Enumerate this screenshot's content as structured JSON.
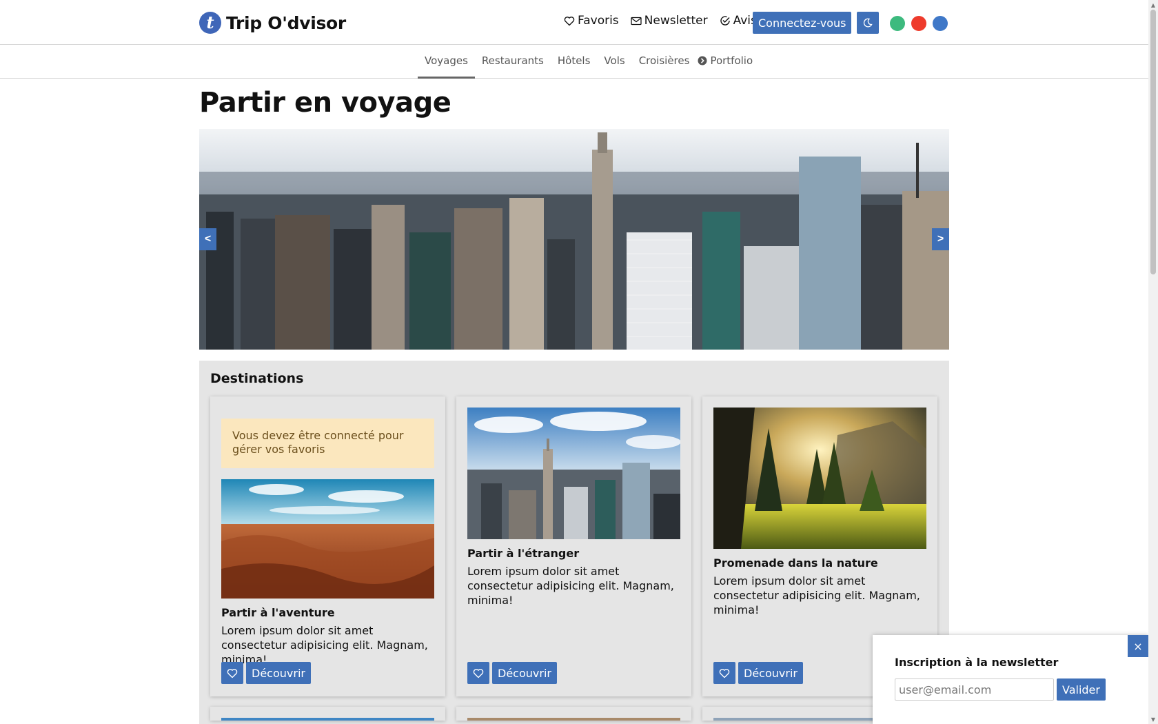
{
  "brand": {
    "logo_letter": "t",
    "name": "Trip O'dvisor"
  },
  "header": {
    "links": [
      {
        "label": "Favoris",
        "icon": "heart-icon"
      },
      {
        "label": "Newsletter",
        "icon": "envelope-icon"
      },
      {
        "label": "Avis",
        "icon": "check-circle-icon"
      }
    ],
    "login_label": "Connectez-vous",
    "theme_icon": "moon-icon",
    "theme_colors": [
      "#3dba7e",
      "#ee3b2c",
      "#3f78c8"
    ]
  },
  "subnav": {
    "items": [
      "Voyages",
      "Restaurants",
      "Hôtels",
      "Vols",
      "Croisières"
    ],
    "active": "Voyages",
    "portfolio_label": "Portfolio"
  },
  "page": {
    "title": "Partir en voyage"
  },
  "carousel": {
    "prev_label": "<",
    "next_label": ">"
  },
  "destinations": {
    "title": "Destinations",
    "alert": "Vous devez être connecté pour gérer vos favoris",
    "cards": [
      {
        "title": "Partir à l'aventure",
        "text": "Lorem ipsum dolor sit amet consectetur adipisicing elit. Magnam, minima!",
        "button": "Découvrir"
      },
      {
        "title": "Partir à l'étranger",
        "text": "Lorem ipsum dolor sit amet consectetur adipisicing elit. Magnam, minima!",
        "button": "Découvrir"
      },
      {
        "title": "Promenade dans la nature",
        "text": "Lorem ipsum dolor sit amet consectetur adipisicing elit. Magnam, minima!",
        "button": "Découvrir"
      }
    ]
  },
  "newsletter_popup": {
    "close_label": "×",
    "title": "Inscription à la newsletter",
    "placeholder": "user@email.com",
    "submit_label": "Valider"
  },
  "colors": {
    "accent": "#3f70b8",
    "alert_bg": "#fbe7be",
    "panel_bg": "#e5e5e5"
  }
}
